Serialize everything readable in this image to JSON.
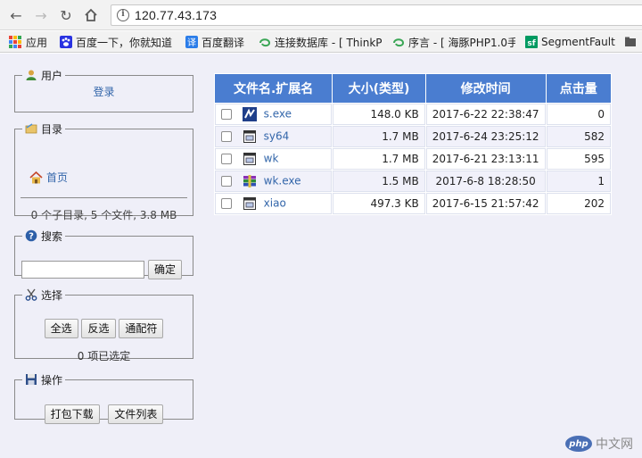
{
  "browser": {
    "url": "120.77.43.173",
    "bookmarks": [
      {
        "label": "应用",
        "icon": "apps-grid-icon"
      },
      {
        "label": "百度一下，你就知道",
        "icon": "baidu-paw-icon"
      },
      {
        "label": "百度翻译",
        "icon": "baidu-translate-icon"
      },
      {
        "label": "连接数据库 - [ ThinkP",
        "icon": "thinkphp-icon"
      },
      {
        "label": "序言 - [ 海豚PHP1.0手",
        "icon": "dolphinphp-icon"
      },
      {
        "label": "SegmentFault",
        "icon": "segmentfault-icon"
      }
    ],
    "colors": {
      "chrome": "#f2f2f2"
    }
  },
  "sidebar": {
    "user": {
      "legend": "用户",
      "login": "登录"
    },
    "dir": {
      "legend": "目录",
      "home": "首页",
      "summary": "0 个子目录, 5 个文件, 3.8 MB"
    },
    "search": {
      "legend": "搜索",
      "placeholder": "",
      "value": "",
      "button": "确定"
    },
    "select": {
      "legend": "选择",
      "all": "全选",
      "invert": "反选",
      "wildcard": "通配符",
      "count": "0 项已选定"
    },
    "actions": {
      "legend": "操作",
      "download": "打包下载",
      "list": "文件列表"
    }
  },
  "table": {
    "headers": [
      "文件名.扩展名",
      "大小(类型)",
      "修改时间",
      "点击量"
    ],
    "rows": [
      {
        "name": "s.exe",
        "size": "148.0 KB",
        "modified": "2017-6-22 22:38:47",
        "clicks": "0",
        "icon": "exe-file-icon"
      },
      {
        "name": "sy64",
        "size": "1.7 MB",
        "modified": "2017-6-24 23:25:12",
        "clicks": "582",
        "icon": "generic-file-icon"
      },
      {
        "name": "wk",
        "size": "1.7 MB",
        "modified": "2017-6-21 23:13:11",
        "clicks": "595",
        "icon": "generic-file-icon"
      },
      {
        "name": "wk.exe",
        "size": "1.5 MB",
        "modified": "2017-6-8 18:28:50",
        "clicks": "1",
        "icon": "archive-exe-icon"
      },
      {
        "name": "xiao",
        "size": "497.3 KB",
        "modified": "2017-6-15 21:57:42",
        "clicks": "202",
        "icon": "generic-file-icon"
      }
    ],
    "colors": {
      "header": "#4a7dd0",
      "row_alt": "#f1f1fa",
      "link": "#3366aa"
    }
  },
  "watermark": {
    "badge": "php",
    "text": "中文网"
  }
}
